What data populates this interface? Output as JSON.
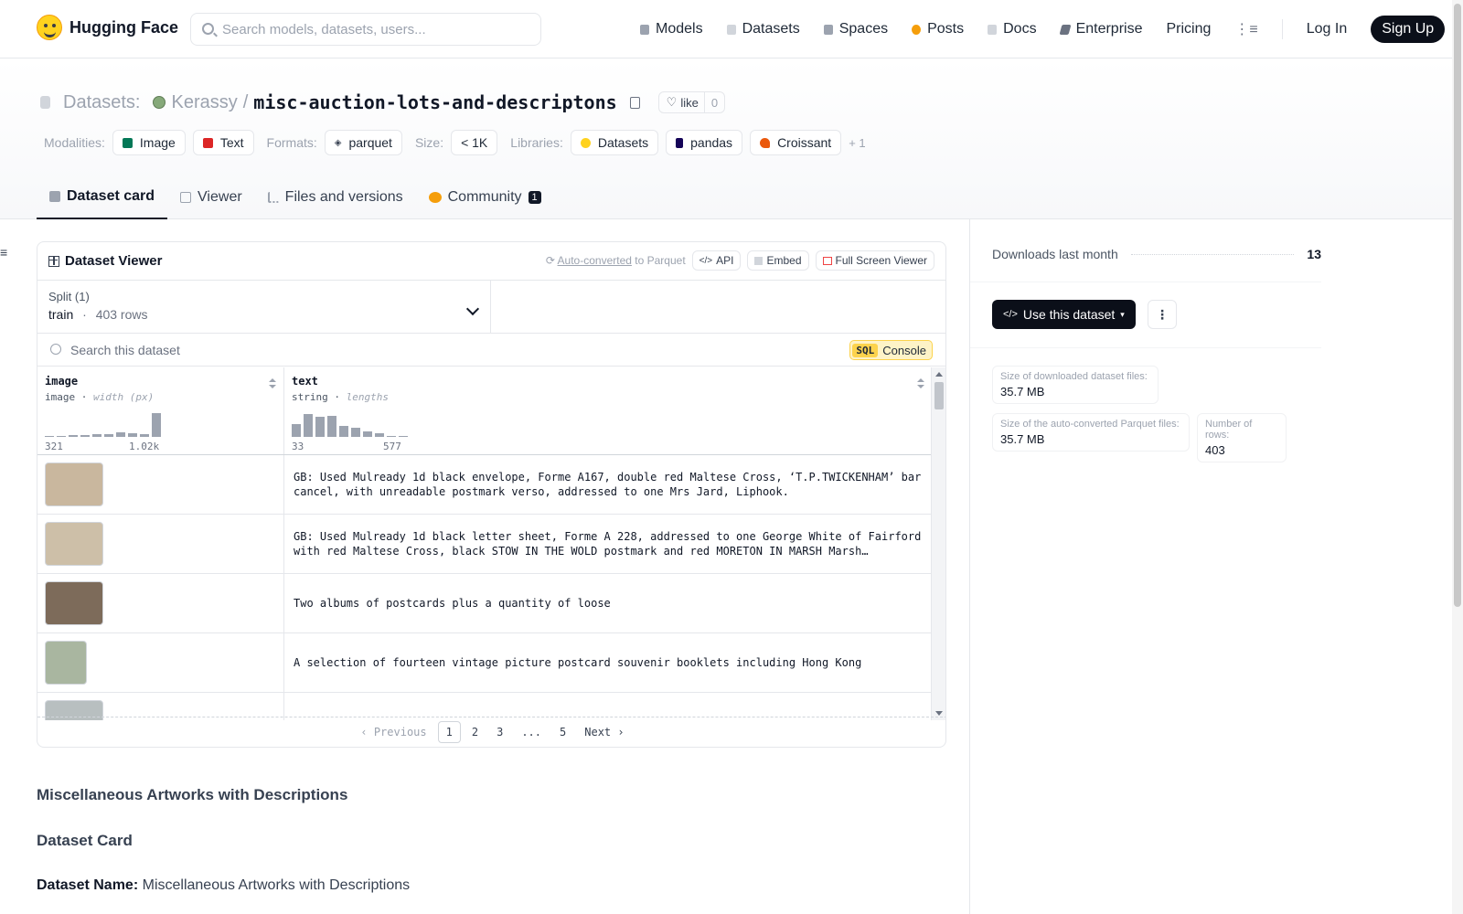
{
  "header": {
    "brand": "Hugging Face",
    "search_placeholder": "Search models, datasets, users...",
    "nav": [
      {
        "label": "Models",
        "icon": "cube-icon",
        "color": "#9ca3af"
      },
      {
        "label": "Datasets",
        "icon": "database-icon",
        "color": "#d1d5db"
      },
      {
        "label": "Spaces",
        "icon": "grid-icon",
        "color": "#9ca3af"
      },
      {
        "label": "Posts",
        "icon": "posts-icon",
        "color": "#f59e0b"
      },
      {
        "label": "Docs",
        "icon": "docs-icon",
        "color": "#d1d5db"
      },
      {
        "label": "Enterprise",
        "icon": "enterprise-icon",
        "color": "#6b7280"
      },
      {
        "label": "Pricing"
      }
    ],
    "login": "Log In",
    "signup": "Sign Up"
  },
  "repo": {
    "type_label": "Datasets:",
    "owner": "Kerassy",
    "separator": "/",
    "name": "misc-auction-lots-and-descriptons",
    "like_label": "like",
    "like_count": "0"
  },
  "tags": {
    "modalities_label": "Modalities:",
    "modalities": [
      {
        "label": "Image",
        "color": "#047857"
      },
      {
        "label": "Text",
        "color": "#dc2626"
      }
    ],
    "formats_label": "Formats:",
    "formats": [
      {
        "label": "parquet",
        "color": "#374151"
      }
    ],
    "size_label": "Size:",
    "size": "< 1K",
    "libraries_label": "Libraries:",
    "libraries": [
      {
        "label": "Datasets",
        "color": "#ffd21e"
      },
      {
        "label": "pandas",
        "color": "#150458"
      },
      {
        "label": "Croissant",
        "color": "#ea580c"
      }
    ],
    "more": "+ 1"
  },
  "tabs": [
    {
      "label": "Dataset card",
      "active": true,
      "color": "#9ca3af"
    },
    {
      "label": "Viewer",
      "active": false,
      "color": "#9ca3af"
    },
    {
      "label": "Files and versions",
      "active": false,
      "color": "#9ca3af"
    },
    {
      "label": "Community",
      "active": false,
      "badge": "1",
      "color": "#f59e0b"
    }
  ],
  "viewer": {
    "title": "Dataset Viewer",
    "auto_converted": "Auto-converted",
    "to_parquet": "to Parquet",
    "api": "API",
    "embed": "Embed",
    "full_screen": "Full Screen Viewer",
    "split_label": "Split (1)",
    "split_name": "train",
    "split_dot": "·",
    "split_rows": "403 rows",
    "search_placeholder": "Search this dataset",
    "sql_tag": "SQL",
    "sql_label": "Console",
    "columns": [
      {
        "name": "image",
        "type": "image",
        "stat": "width (px)",
        "min": "321",
        "max": "1.02k",
        "hist": [
          0.05,
          0,
          0.08,
          0.08,
          0.1,
          0.12,
          0.18,
          0.15,
          0.12,
          1.0
        ]
      },
      {
        "name": "text",
        "type": "string",
        "stat": "lengths",
        "min": "33",
        "max": "577",
        "hist": [
          0.55,
          0.95,
          0.85,
          0.9,
          0.45,
          0.4,
          0.22,
          0.15,
          0.05,
          0.05
        ]
      }
    ],
    "rows": [
      {
        "thumb": "#c9b79e",
        "text": "GB: Used Mulready 1d black envelope, Forme A167, double red Maltese Cross, ‘T.P.TWICKENHAM’ bar cancel, with unreadable postmark verso, addressed to one Mrs Jard, Liphook."
      },
      {
        "thumb": "#cdbfa8",
        "text": "GB: Used Mulready 1d black letter sheet, Forme A 228, addressed to one George White of Fairford with red Maltese Cross, black STOW IN THE WOLD postmark and red MORETON IN MARSH Marsh receiver…"
      },
      {
        "thumb": "#7d6b5a",
        "text": "Two albums of postcards plus a quantity of loose"
      },
      {
        "thumb": "#a9b6a0",
        "text": "A selection of fourteen vintage picture postcard souvenir booklets including Hong Kong"
      },
      {
        "thumb": "#b8bfc0",
        "text": ""
      }
    ],
    "pager": {
      "prev": "‹ Previous",
      "pages": [
        "1",
        "2",
        "3",
        "...",
        "5"
      ],
      "current": "1",
      "next": "Next ›"
    }
  },
  "readme": {
    "h1": "Miscellaneous Artworks with Descriptions",
    "h2": "Dataset Card",
    "name_label": "Dataset Name:",
    "name_value": "Miscellaneous Artworks with Descriptions"
  },
  "sidebar": {
    "downloads_label": "Downloads last month",
    "downloads_value": "13",
    "use_dataset": "Use this dataset",
    "stats": [
      {
        "k": "Size of downloaded dataset files:",
        "v": "35.7 MB"
      },
      {
        "k": "Size of the auto-converted Parquet files:",
        "v": "35.7 MB"
      },
      {
        "k": "Number of rows:",
        "v": "403"
      }
    ]
  }
}
